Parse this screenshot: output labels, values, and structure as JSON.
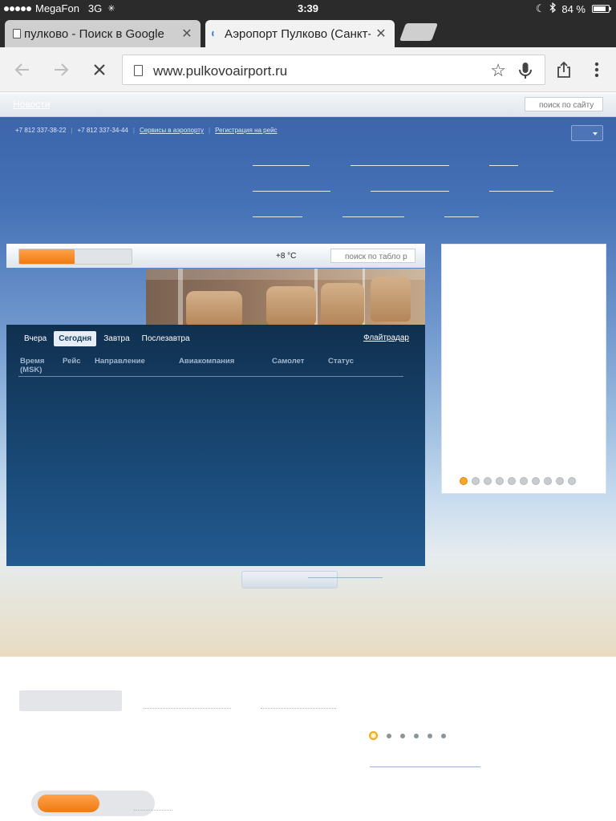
{
  "status_bar": {
    "carrier": "MegaFon",
    "network": "3G",
    "time": "3:39",
    "battery_text": "84 %",
    "battery_level": 0.84
  },
  "browser": {
    "tabs": [
      {
        "title": "пулково - Поиск в Google",
        "active": false
      },
      {
        "title": "Аэропорт Пулково (Санкт-",
        "active": true
      }
    ],
    "url": "www.pulkovoairport.ru"
  },
  "page": {
    "news_link": "Новости",
    "site_search_placeholder": "поиск по сайту",
    "topline": {
      "phone_1": "+7 812 337-38-22",
      "phone_2": "+7 812 337-34-44",
      "services_link": "Сервисы в аэропорту",
      "checkin_link": "Регистрация на рейс"
    },
    "board": {
      "toggle_on_fraction": 0.49,
      "weather": "+8 °C",
      "search_placeholder": "поиск по табло р",
      "day_tabs": [
        "Вчера",
        "Сегодня",
        "Завтра",
        "Послезавтра"
      ],
      "active_day_index": 1,
      "flightradar_link": "Флайтрадар",
      "columns": [
        "Время (MSK)",
        "Рейс",
        "Направление",
        "Авиакомпания",
        "Самолет",
        "Статус"
      ]
    },
    "carousel": {
      "dot_count": 10,
      "active_index": 0
    },
    "pager": {
      "dot_count": 6,
      "active_index": 0
    },
    "bottom_toggle_on_fraction": 0.56
  }
}
